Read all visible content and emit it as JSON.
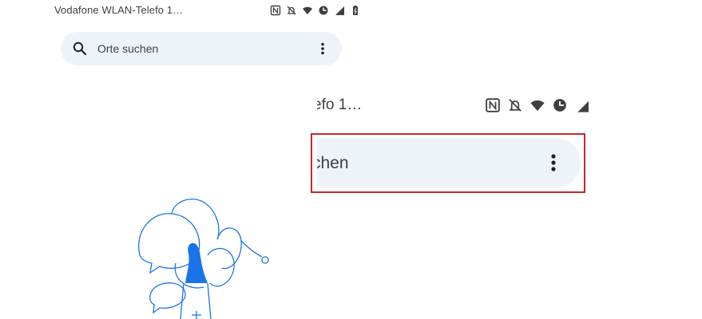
{
  "status_bar": {
    "carrier": "Vodafone WLAN-Telefo 1…",
    "icons": [
      "nfc-icon",
      "notifications-off-icon",
      "wifi-icon",
      "data-saver-icon",
      "signal-icon",
      "battery-icon"
    ]
  },
  "search": {
    "placeholder": "Orte suchen"
  },
  "zoom": {
    "carrier_fragment": "efo 1…",
    "search_fragment": "chen",
    "icons": [
      "nfc-icon",
      "notifications-off-icon",
      "wifi-icon",
      "data-saver-icon",
      "signal-icon"
    ]
  },
  "colors": {
    "highlight": "#c62828",
    "search_bg": "#eef2f9",
    "illustration_blue": "#1a73e8"
  }
}
